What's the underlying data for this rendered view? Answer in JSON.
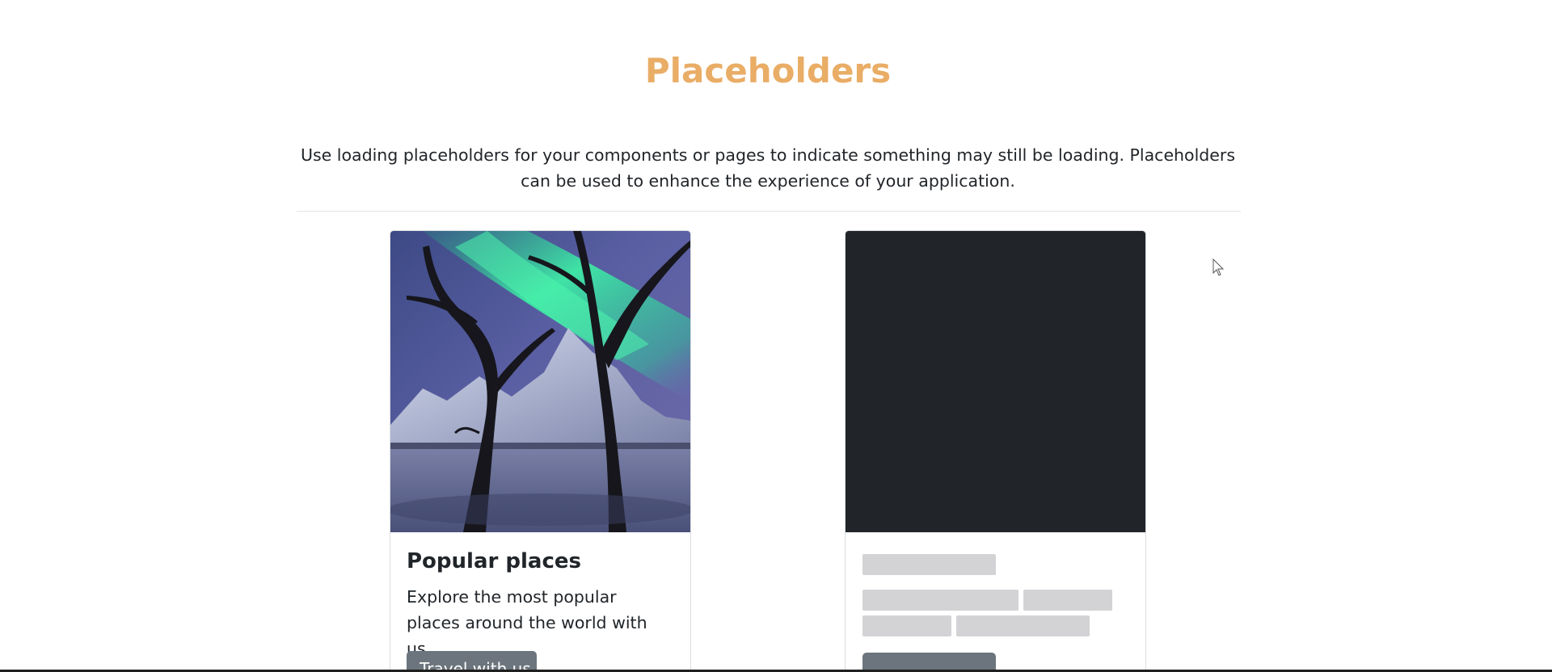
{
  "header": {
    "title": "Placeholders",
    "lead": "Use loading placeholders for your components or pages to indicate something may still be loading. Placeholders can be used to enhance the experience of your application."
  },
  "cards": [
    {
      "image": "aurora-winter-trees-photo",
      "title": "Popular places",
      "text": "Explore the most popular places around the world with us.",
      "button_label": "Travel with us"
    },
    {
      "image": "loading-placeholder",
      "state": "loading"
    }
  ],
  "colors": {
    "title": "#e9ad66",
    "text": "#212529",
    "placeholder_image": "#212529",
    "placeholder_bar": "#d3d3d6",
    "button": "#6c757d"
  },
  "icons": {
    "cursor": "mouse-pointer-icon"
  }
}
